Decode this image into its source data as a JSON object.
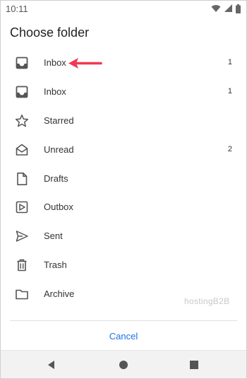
{
  "status_bar": {
    "time": "10:11",
    "icons": [
      "wifi-icon",
      "signal-icon",
      "battery-icon"
    ]
  },
  "dialog": {
    "title": "Choose folder",
    "cancel_label": "Cancel"
  },
  "folders": [
    {
      "label": "Inbox",
      "count": "1",
      "icon": "inbox-icon"
    },
    {
      "label": "Inbox",
      "count": "1",
      "icon": "inbox-icon"
    },
    {
      "label": "Starred",
      "count": "",
      "icon": "star-icon"
    },
    {
      "label": "Unread",
      "count": "2",
      "icon": "open-envelope-icon"
    },
    {
      "label": "Drafts",
      "count": "",
      "icon": "draft-document-icon"
    },
    {
      "label": "Outbox",
      "count": "",
      "icon": "outbox-icon"
    },
    {
      "label": "Sent",
      "count": "",
      "icon": "send-icon"
    },
    {
      "label": "Trash",
      "count": "",
      "icon": "trash-icon"
    },
    {
      "label": "Archive",
      "count": "",
      "icon": "archive-folder-icon"
    }
  ],
  "watermark": "hostingB2B",
  "colors": {
    "accent": "#1a73e8",
    "annotation_arrow": "#f0394f",
    "icon": "#555555"
  },
  "nav_bar": {
    "icons": [
      "back-icon",
      "home-icon",
      "recents-icon"
    ]
  }
}
